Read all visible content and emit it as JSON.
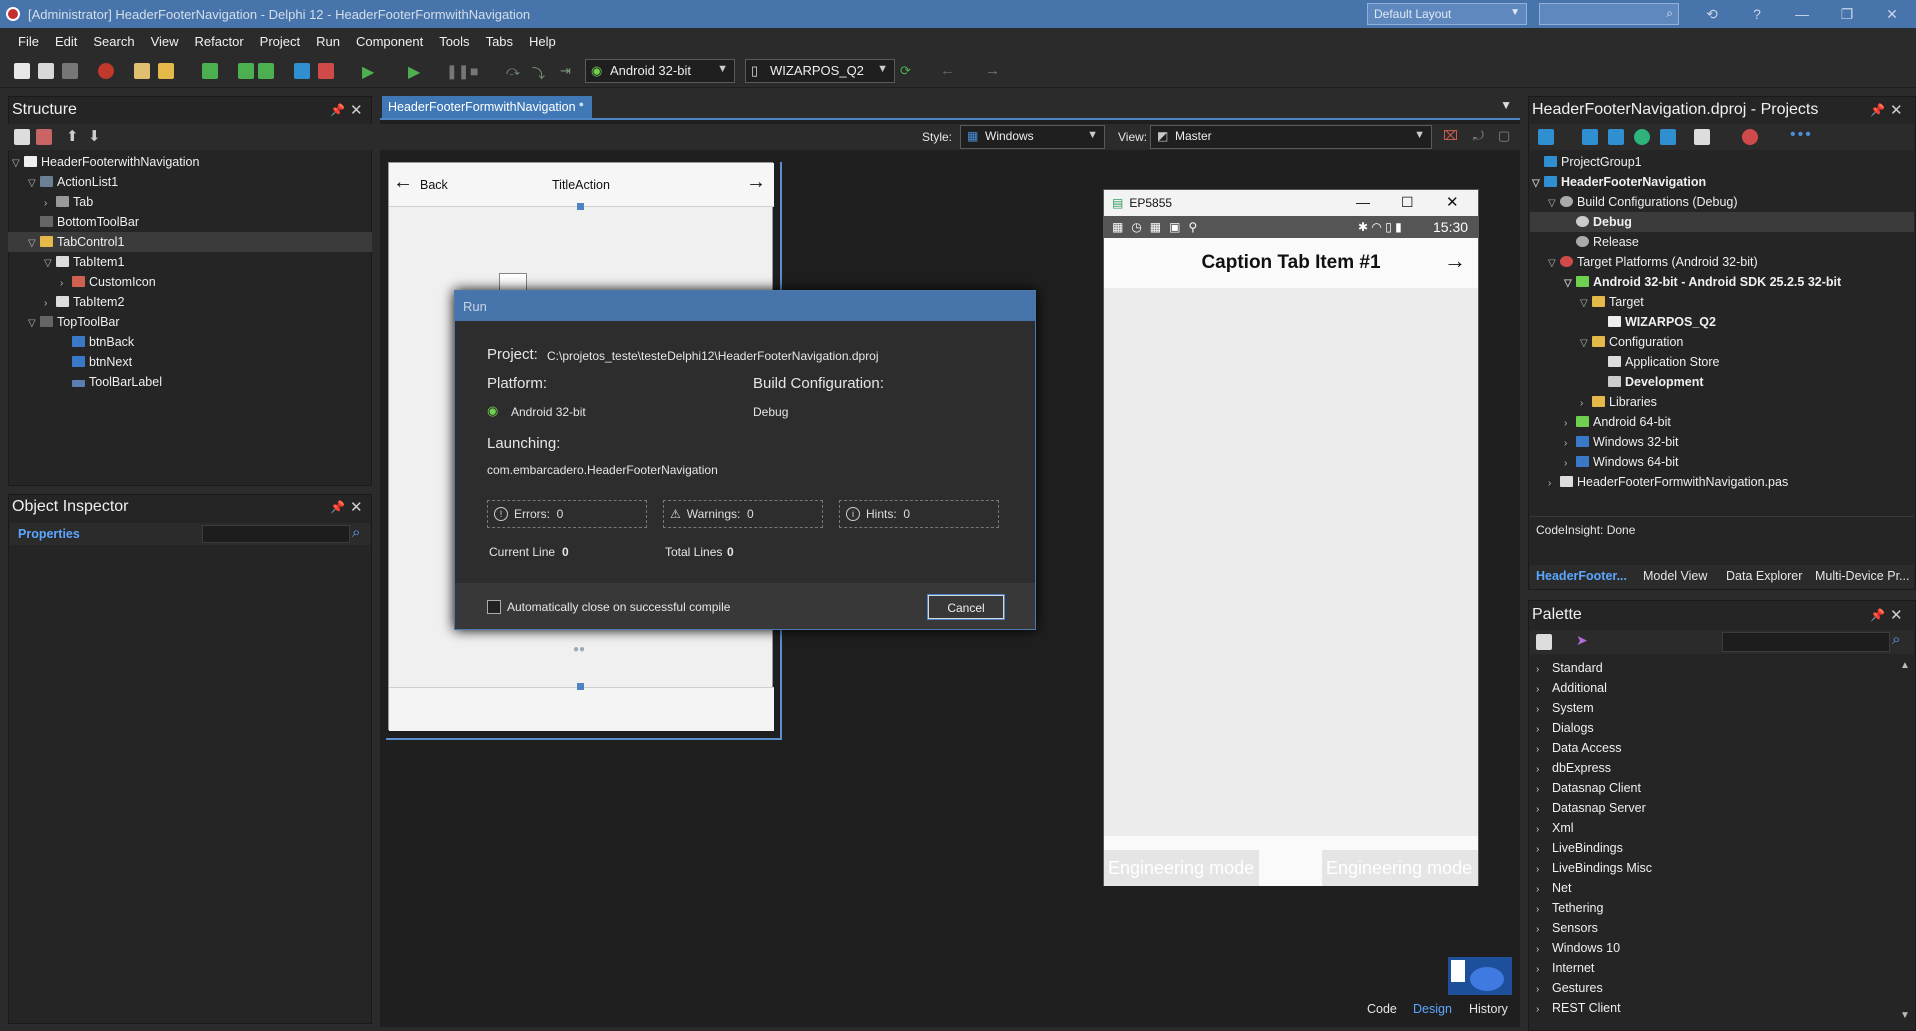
{
  "window": {
    "title": "[Administrator] HeaderFooterNavigation - Delphi 12 - HeaderFooterFormwithNavigation",
    "layout_combo": "Default Layout"
  },
  "menu": [
    "File",
    "Edit",
    "Search",
    "View",
    "Refactor",
    "Project",
    "Run",
    "Component",
    "Tools",
    "Tabs",
    "Help"
  ],
  "toolbar": {
    "platform": "Android 32-bit",
    "device": "WIZARPOS_Q2"
  },
  "structure": {
    "title": "Structure",
    "items": [
      {
        "label": "HeaderFooterwithNavigation"
      },
      {
        "label": "ActionList1"
      },
      {
        "label": "Tab"
      },
      {
        "label": "BottomToolBar"
      },
      {
        "label": "TabControl1"
      },
      {
        "label": "TabItem1"
      },
      {
        "label": "CustomIcon"
      },
      {
        "label": "TabItem2"
      },
      {
        "label": "TopToolBar"
      },
      {
        "label": "btnBack"
      },
      {
        "label": "btnNext"
      },
      {
        "label": "ToolBarLabel"
      }
    ]
  },
  "inspector": {
    "title": "Object Inspector",
    "tab": "Properties"
  },
  "editor": {
    "tab": "HeaderFooterFormwithNavigation",
    "style_label": "Style:",
    "style_value": "Windows",
    "view_label": "View:",
    "view_value": "Master",
    "form_back": "Back",
    "form_title": "TitleAction",
    "bottom_tabs": [
      "Code",
      "Design",
      "History"
    ]
  },
  "run_dialog": {
    "title": "Run",
    "project_label": "Project:",
    "project_value": "C:\\projetos_teste\\testeDelphi12\\HeaderFooterNavigation.dproj",
    "platform_label": "Platform:",
    "platform_value": "Android 32-bit",
    "build_label": "Build Configuration:",
    "build_value": "Debug",
    "launching_label": "Launching:",
    "launching_value": "com.embarcadero.HeaderFooterNavigation",
    "errors_label": "Errors:",
    "errors": "0",
    "warnings_label": "Warnings:",
    "warnings": "0",
    "hints_label": "Hints:",
    "hints": "0",
    "current_line_label": "Current Line",
    "current_line": "0",
    "total_lines_label": "Total Lines",
    "total_lines": "0",
    "autoclose_label": "Automatically close on successful compile",
    "cancel_label": "Cancel"
  },
  "emulator": {
    "title": "EP5855",
    "time": "15:30",
    "caption": "Caption Tab Item #1",
    "footer_left": "Engineering mode",
    "footer_right": "Engineering mode"
  },
  "projects": {
    "title": "HeaderFooterNavigation.dproj - Projects",
    "items": [
      {
        "label": "ProjectGroup1"
      },
      {
        "label": "HeaderFooterNavigation"
      },
      {
        "label": "Build Configurations (Debug)"
      },
      {
        "label": "Debug"
      },
      {
        "label": "Release"
      },
      {
        "label": "Target Platforms (Android 32-bit)"
      },
      {
        "label": "Android 32-bit - Android SDK 25.2.5 32-bit"
      },
      {
        "label": "Target"
      },
      {
        "label": "WIZARPOS_Q2"
      },
      {
        "label": "Configuration"
      },
      {
        "label": "Application Store"
      },
      {
        "label": "Development"
      },
      {
        "label": "Libraries"
      },
      {
        "label": "Android 64-bit"
      },
      {
        "label": "Windows 32-bit"
      },
      {
        "label": "Windows 64-bit"
      },
      {
        "label": "HeaderFooterFormwithNavigation.pas"
      }
    ],
    "codeinsight": "CodeInsight: Done",
    "tabs": [
      "HeaderFooter...",
      "Model View",
      "Data Explorer",
      "Multi-Device Pr..."
    ]
  },
  "palette": {
    "title": "Palette",
    "items": [
      "Standard",
      "Additional",
      "System",
      "Dialogs",
      "Data Access",
      "dbExpress",
      "Datasnap Client",
      "Datasnap Server",
      "Xml",
      "LiveBindings",
      "LiveBindings Misc",
      "Net",
      "Tethering",
      "Sensors",
      "Windows 10",
      "Internet",
      "Gestures",
      "REST Client"
    ]
  }
}
